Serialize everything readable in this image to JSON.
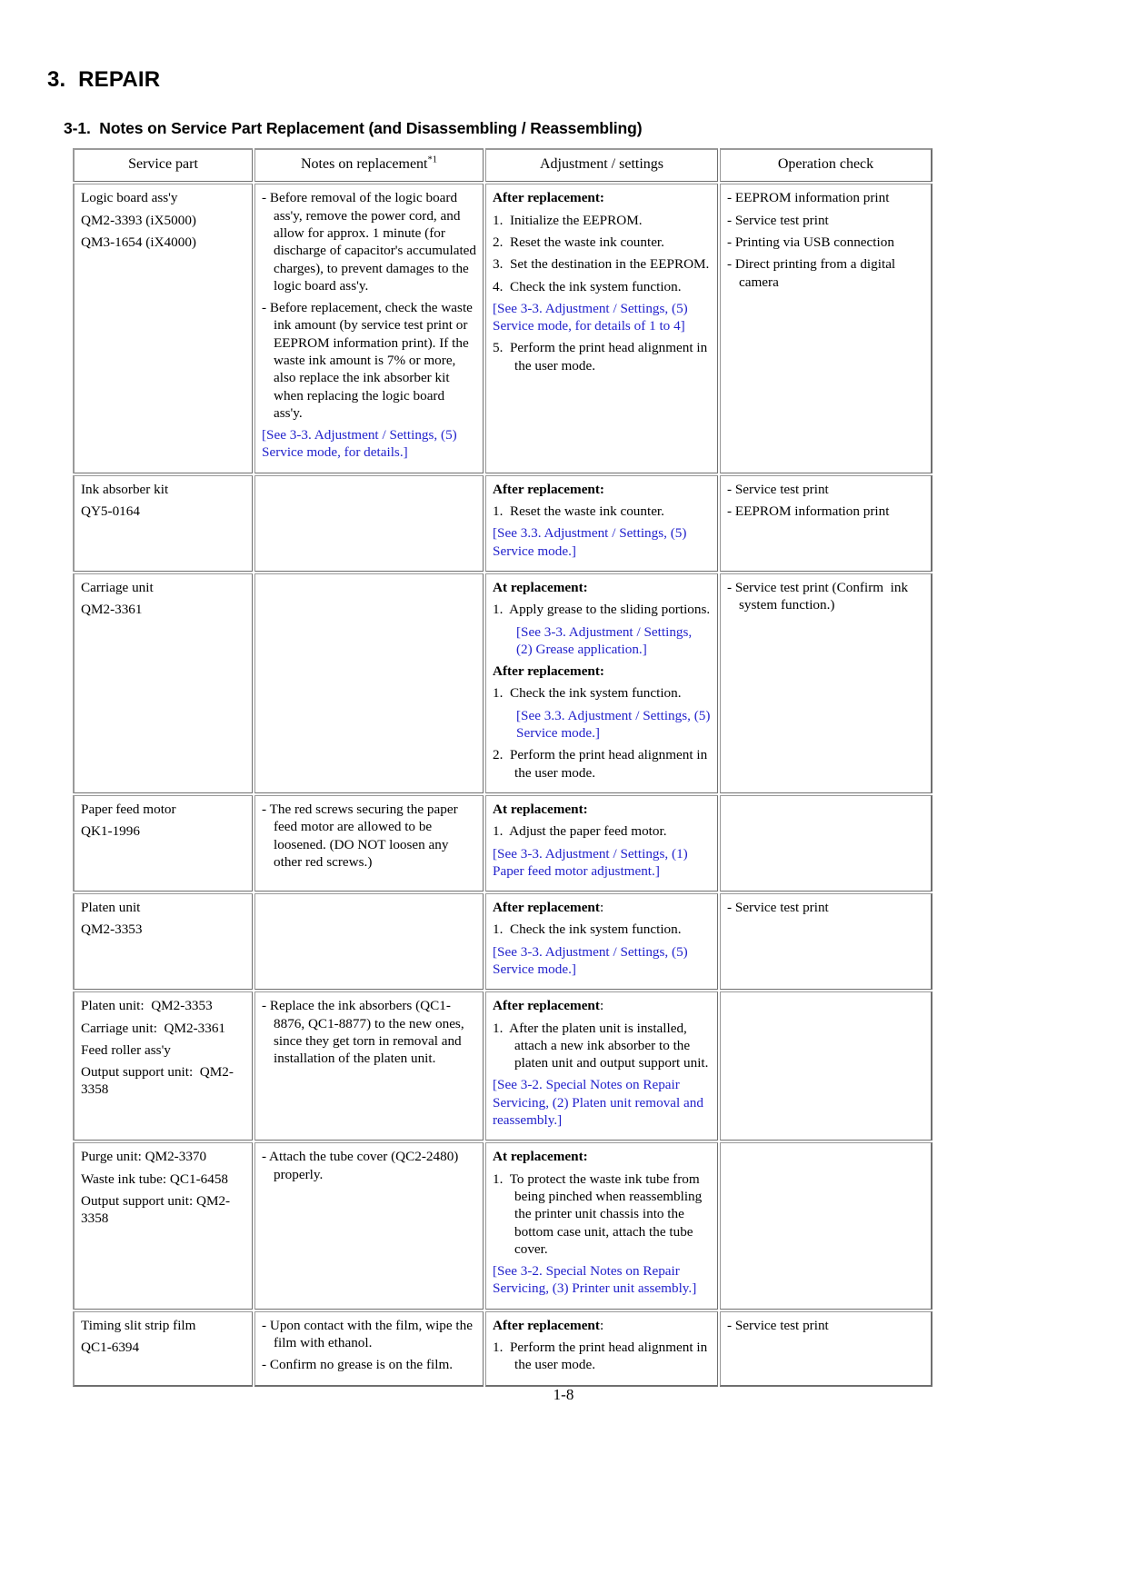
{
  "document": {
    "chapter_title": "3.  REPAIR",
    "section_title": "3-1.  Notes on Service Part Replacement (and Disassembling / Reassembling)",
    "page_number": "1-8",
    "footnote_marker": "*1",
    "link_color": "#2222cc"
  },
  "table": {
    "headers": {
      "service_part": "Service part",
      "notes": "Notes on replacement",
      "adjustment": "Adjustment / settings",
      "operation": "Operation check"
    },
    "rows": [
      {
        "service_part": [
          "Logic board ass'y",
          "QM2-3393 (iX5000)",
          "QM3-1654 (iX4000)"
        ],
        "notes": [
          {
            "type": "dash",
            "text": "- Before removal of the logic board ass'y, remove the power cord, and allow for approx. 1 minute (for discharge of capacitor's accumulated charges), to prevent damages to the logic board ass'y."
          },
          {
            "type": "dash",
            "text": "- Before replacement, check the waste ink amount (by service test print or EEPROM information print). If the waste ink amount is 7% or more, also replace the ink absorber kit when replacing the logic board ass'y."
          },
          {
            "type": "ref",
            "text": "[See 3-3. Adjustment / Settings, (5) Service mode, for details.]"
          }
        ],
        "adjustment": [
          {
            "type": "bold",
            "text": "After replacement:"
          },
          {
            "type": "num",
            "text": "1.  Initialize the EEPROM."
          },
          {
            "type": "num",
            "text": "2.  Reset the waste ink counter."
          },
          {
            "type": "num",
            "text": "3.  Set the destination in the EEPROM."
          },
          {
            "type": "num",
            "text": "4.  Check the ink system function."
          },
          {
            "type": "ref",
            "text": "[See 3-3. Adjustment / Settings, (5) Service mode, for details of 1 to 4]"
          },
          {
            "type": "num",
            "text": "5.  Perform the print head alignment in the user mode."
          }
        ],
        "operation": [
          {
            "type": "dash",
            "text": "- EEPROM information print"
          },
          {
            "type": "dash",
            "text": "- Service test print"
          },
          {
            "type": "dash",
            "text": "- Printing via USB connection"
          },
          {
            "type": "dash",
            "text": "- Direct printing from a digital camera"
          }
        ]
      },
      {
        "service_part": [
          "Ink absorber kit",
          "QY5-0164"
        ],
        "notes": [],
        "adjustment": [
          {
            "type": "bold",
            "text": "After replacement:"
          },
          {
            "type": "num",
            "text": "1.  Reset the waste ink counter."
          },
          {
            "type": "ref",
            "text": "[See 3.3. Adjustment / Settings, (5) Service mode.]"
          }
        ],
        "operation": [
          {
            "type": "dash",
            "text": "- Service test print"
          },
          {
            "type": "dash",
            "text": "- EEPROM information print"
          }
        ]
      },
      {
        "service_part": [
          "Carriage unit",
          "QM2-3361"
        ],
        "notes": [],
        "adjustment": [
          {
            "type": "bold",
            "text": "At replacement:"
          },
          {
            "type": "num",
            "text": "1.  Apply grease to the sliding portions."
          },
          {
            "type": "ref-indent",
            "text": "[See 3-3. Adjustment / Settings, (2) Grease application.]"
          },
          {
            "type": "bold",
            "text": "After replacement:"
          },
          {
            "type": "num",
            "text": "1.  Check the ink system function."
          },
          {
            "type": "ref-indent",
            "text": "[See 3.3. Adjustment / Settings, (5) Service mode.]"
          },
          {
            "type": "num",
            "text": "2.  Perform the print head alignment in the user mode."
          }
        ],
        "operation": [
          {
            "type": "dash",
            "text": "- Service test print (Confirm  ink system function.)"
          }
        ]
      },
      {
        "service_part": [
          "Paper feed motor",
          "QK1-1996"
        ],
        "notes": [
          {
            "type": "dash",
            "text": "- The red screws securing the paper feed motor are allowed to be loosened. (DO NOT loosen any other red screws.)"
          }
        ],
        "adjustment": [
          {
            "type": "bold",
            "text": "At replacement:"
          },
          {
            "type": "num",
            "text": "1.  Adjust the paper feed motor."
          },
          {
            "type": "ref",
            "text": "[See 3-3. Adjustment / Settings, (1) Paper feed motor adjustment.]"
          }
        ],
        "operation": []
      },
      {
        "service_part": [
          "Platen unit",
          "QM2-3353"
        ],
        "notes": [],
        "adjustment": [
          {
            "type": "bold-colon",
            "text": "After replacement",
            "tail": ":"
          },
          {
            "type": "num",
            "text": "1.  Check the ink system function."
          },
          {
            "type": "ref",
            "text": "[See 3-3. Adjustment / Settings, (5) Service mode.]"
          }
        ],
        "operation": [
          {
            "type": "dash",
            "text": "- Service test print"
          }
        ]
      },
      {
        "service_part": [
          "Platen unit:  QM2-3353",
          "Carriage unit:  QM2-3361",
          "Feed roller ass'y",
          "Output support unit:  QM2-3358"
        ],
        "notes": [
          {
            "type": "dash",
            "text": "- Replace the ink absorbers (QC1-8876, QC1-8877) to the new ones, since they get torn in removal and installation of the platen unit."
          }
        ],
        "adjustment": [
          {
            "type": "bold-colon",
            "text": "After replacement",
            "tail": ":"
          },
          {
            "type": "num",
            "text": "1.  After the platen unit is installed, attach a new ink absorber to the platen unit and output support unit."
          },
          {
            "type": "ref",
            "text": "[See 3-2. Special Notes on Repair Servicing, (2) Platen unit removal and reassembly.]"
          }
        ],
        "operation": []
      },
      {
        "service_part": [
          "Purge unit: QM2-3370",
          "Waste ink tube: QC1-6458",
          "Output support unit: QM2-3358"
        ],
        "notes": [
          {
            "type": "dash",
            "text": "- Attach the tube cover (QC2-2480) properly."
          }
        ],
        "adjustment": [
          {
            "type": "bold",
            "text": "At replacement:"
          },
          {
            "type": "num",
            "text": "1.  To protect the waste ink tube from being pinched when reassembling the printer unit chassis into the bottom case unit, attach the tube cover."
          },
          {
            "type": "ref",
            "text": "[See 3-2. Special Notes on Repair Servicing, (3) Printer unit assembly.]"
          }
        ],
        "operation": []
      },
      {
        "service_part": [
          "Timing slit strip film",
          "QC1-6394"
        ],
        "notes": [
          {
            "type": "dash",
            "text": "- Upon contact with the film, wipe the film with ethanol."
          },
          {
            "type": "dash",
            "text": "- Confirm no grease is on the film."
          }
        ],
        "adjustment": [
          {
            "type": "bold-colon",
            "text": "After replacement",
            "tail": ":"
          },
          {
            "type": "num",
            "text": "1.  Perform the print head alignment in the user mode."
          }
        ],
        "operation": [
          {
            "type": "dash",
            "text": "- Service test print"
          }
        ]
      }
    ]
  }
}
